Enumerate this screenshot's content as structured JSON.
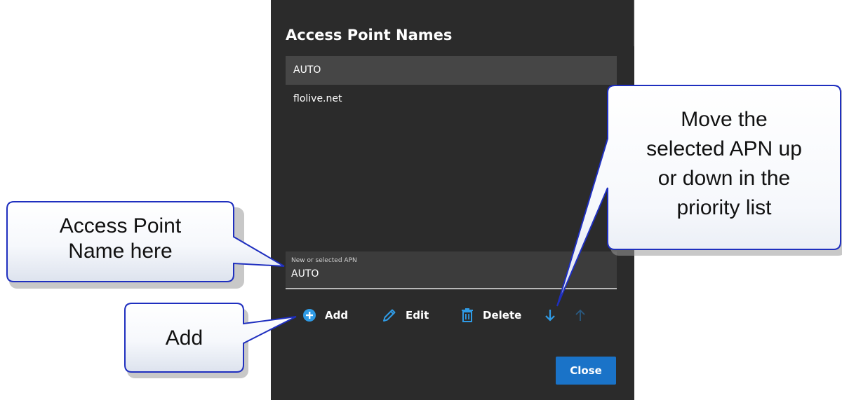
{
  "dialog": {
    "title": "Access Point Names",
    "apn_list": [
      "AUTO",
      "flolive.net"
    ],
    "selected_index": 0,
    "field": {
      "label": "New or selected APN",
      "value": "AUTO"
    },
    "toolbar": {
      "add_label": "Add",
      "edit_label": "Edit",
      "delete_label": "Delete",
      "add_icon": "plus-circle-icon",
      "edit_icon": "pencil-icon",
      "delete_icon": "trash-icon",
      "down_icon": "arrow-down-icon",
      "up_icon": "arrow-up-icon"
    },
    "close_label": "Close"
  },
  "callouts": {
    "name": [
      "Access Point",
      "Name here"
    ],
    "add": "Add",
    "move": [
      "Move the",
      "selected APN up",
      "or down in the",
      "priority list"
    ]
  },
  "colors": {
    "dialog_bg": "#2b2b2b",
    "selected_row": "#464646",
    "accent": "#1a73c8",
    "icon_blue": "#2f9be6",
    "callout_border": "#1f2fbf"
  }
}
